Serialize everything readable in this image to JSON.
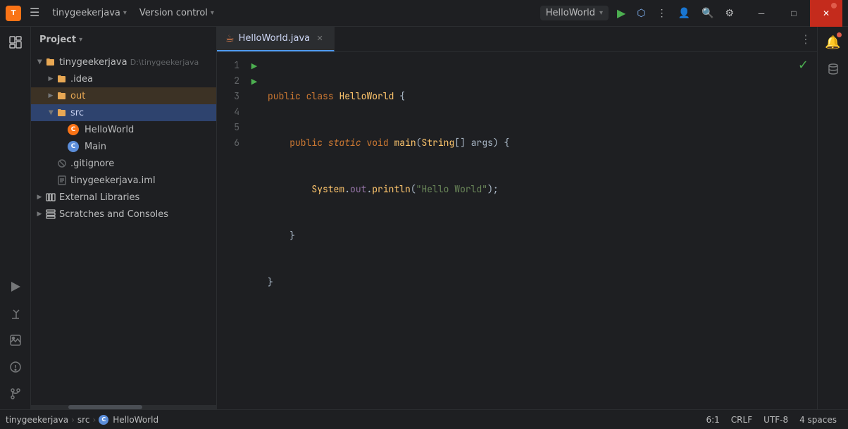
{
  "titleBar": {
    "logo": "T",
    "menuBtn": "☰",
    "projectName": "tinygeekerjava",
    "projectChevron": "▾",
    "versionControl": "Version control",
    "versionControlChevron": "▾",
    "runConfig": "HelloWorld",
    "runConfigChevron": "▾",
    "runBtn": "▶",
    "debugBtn": "🐛",
    "moreBtn": "⋮",
    "searchBtn": "🔍",
    "settingsBtn": "⚙",
    "minBtn": "─",
    "maxBtn": "□",
    "closeBtn": "✕"
  },
  "activityBar": {
    "icons": [
      "📁",
      "🎯",
      "🔧",
      "📷",
      "⚠",
      "🔀"
    ]
  },
  "sidebar": {
    "title": "Project",
    "chevron": "▾",
    "projectRoot": "tinygeekerjava",
    "projectPath": "D:\\tinygeekerjava",
    "items": [
      {
        "label": ".idea",
        "type": "folder",
        "depth": 1,
        "expanded": false
      },
      {
        "label": "out",
        "type": "folder",
        "depth": 1,
        "expanded": false,
        "highlighted": true
      },
      {
        "label": "src",
        "type": "folder",
        "depth": 1,
        "expanded": true,
        "selected": false
      },
      {
        "label": "HelloWorld",
        "type": "java-class",
        "depth": 2,
        "selected": false
      },
      {
        "label": "Main",
        "type": "java-class",
        "depth": 2,
        "selected": false
      },
      {
        "label": ".gitignore",
        "type": "gitignore",
        "depth": 1
      },
      {
        "label": "tinygeekerjava.iml",
        "type": "iml",
        "depth": 1
      },
      {
        "label": "External Libraries",
        "type": "library",
        "depth": 1,
        "expanded": false
      },
      {
        "label": "Scratches and Consoles",
        "type": "scratches",
        "depth": 1,
        "expanded": false
      }
    ]
  },
  "editorTab": {
    "icon": "☕",
    "filename": "HelloWorld.java",
    "active": true,
    "moreIcon": "⋮"
  },
  "code": {
    "lines": [
      {
        "num": 1,
        "hasGutter": true,
        "content": "public class HelloWorld {"
      },
      {
        "num": 2,
        "hasGutter": true,
        "content": "    public static void main(String[] args) {"
      },
      {
        "num": 3,
        "hasGutter": false,
        "content": "        System.out.println(\"Hello World\");"
      },
      {
        "num": 4,
        "hasGutter": false,
        "content": "    }"
      },
      {
        "num": 5,
        "hasGutter": false,
        "content": "}"
      },
      {
        "num": 6,
        "hasGutter": false,
        "content": ""
      }
    ]
  },
  "statusBar": {
    "breadcrumb1": "tinygeekerjava",
    "breadcrumb2": "src",
    "breadcrumb3": "HelloWorld",
    "position": "6:1",
    "lineEnding": "CRLF",
    "encoding": "UTF-8",
    "indent": "4 spaces"
  }
}
